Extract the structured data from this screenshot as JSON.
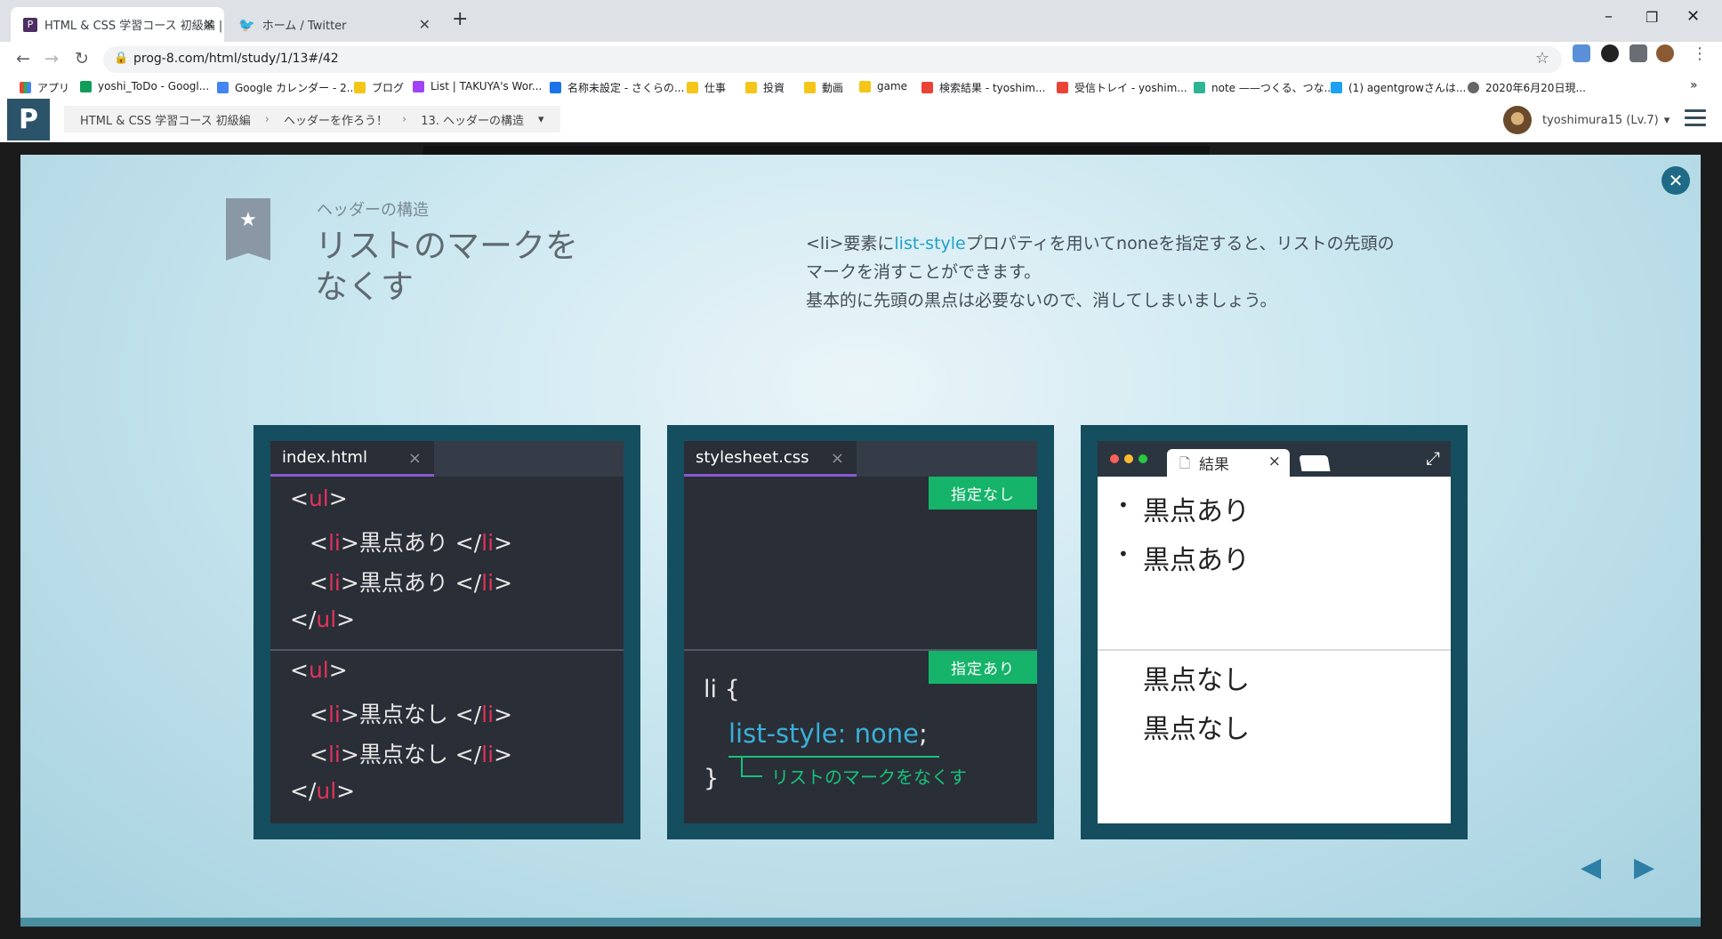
{
  "browser": {
    "tabs": [
      {
        "label": "HTML & CSS 学習コース 初級編 |",
        "favicon": "progate-icon",
        "active": true
      },
      {
        "label": "ホーム / Twitter",
        "favicon": "twitter-icon",
        "active": false
      }
    ],
    "new_tab": "+",
    "window_controls": {
      "minimize": "–",
      "restore": "❐",
      "close": "✕"
    },
    "url": "prog-8.com/html/study/1/13#/42",
    "bookmarks": [
      {
        "label": "アプリ",
        "icon": "apps-grid-icon"
      },
      {
        "label": "yoshi_ToDo - Googl...",
        "icon": "sheets-icon"
      },
      {
        "label": "Google カレンダー - 2...",
        "icon": "calendar-icon"
      },
      {
        "label": "ブログ",
        "icon": "folder-icon"
      },
      {
        "label": "List | TAKUYA's Wor...",
        "icon": "site-icon"
      },
      {
        "label": "名称未設定 - さくらの...",
        "icon": "site-icon"
      },
      {
        "label": "仕事",
        "icon": "folder-icon"
      },
      {
        "label": "投資",
        "icon": "folder-icon"
      },
      {
        "label": "動画",
        "icon": "folder-icon"
      },
      {
        "label": "game",
        "icon": "folder-icon"
      },
      {
        "label": "検索結果 - tyoshim...",
        "icon": "gmail-icon"
      },
      {
        "label": "受信トレイ - yoshim...",
        "icon": "gmail-icon"
      },
      {
        "label": "note ——つくる、つな...",
        "icon": "note-icon"
      },
      {
        "label": "(1) agentgrowさんは...",
        "icon": "twitter-icon"
      },
      {
        "label": "2020年6月20日現...",
        "icon": "globe-icon"
      }
    ],
    "more_bookmarks": "»"
  },
  "site": {
    "logo": "P",
    "breadcrumbs": [
      "HTML & CSS 学習コース 初級編",
      "ヘッダーを作ろう！",
      "13. ヘッダーの構造"
    ],
    "user": "tyoshimura15 (Lv.7)"
  },
  "slide": {
    "subtitle": "ヘッダーの構造",
    "title_line1": "リストのマークを",
    "title_line2": "なくす",
    "desc_pre": "<li>要素に",
    "desc_hl": "list-style",
    "desc_post": "プロパティを用いてnoneを指定すると、リストの先頭の",
    "desc_line2": "マークを消すことができます。",
    "desc_line3": "基本的に先頭の黒点は必要ないので、消してしまいましょう。",
    "colors": {
      "accent": "#1fa0c6",
      "panel": "#154e5f",
      "badge": "#16b36a",
      "tag": "#e2335a"
    }
  },
  "html_panel": {
    "filename": "index.html",
    "close": "×",
    "b1": {
      "open": "ul",
      "items": [
        "黒点あり",
        "黒点あり"
      ],
      "li": "li"
    },
    "b2": {
      "open": "ul",
      "items": [
        "黒点なし",
        "黒点なし"
      ],
      "li": "li"
    },
    "lt": "<",
    "gt": ">",
    "lt_slash": "</"
  },
  "css_panel": {
    "filename": "stylesheet.css",
    "close": "×",
    "badge_none": "指定なし",
    "badge_set": "指定あり",
    "selector": "li {",
    "prop": "list-style: none",
    "semi": ";",
    "close_brace": "}",
    "annotation": "リストのマークをなくす"
  },
  "result_panel": {
    "tab": "結果",
    "close": "×",
    "with_dots": [
      "黒点あり",
      "黒点あり"
    ],
    "bullet": "•",
    "no_dots": [
      "黒点なし",
      "黒点なし"
    ]
  },
  "nav": {
    "prev": "◀",
    "next": "▶"
  }
}
